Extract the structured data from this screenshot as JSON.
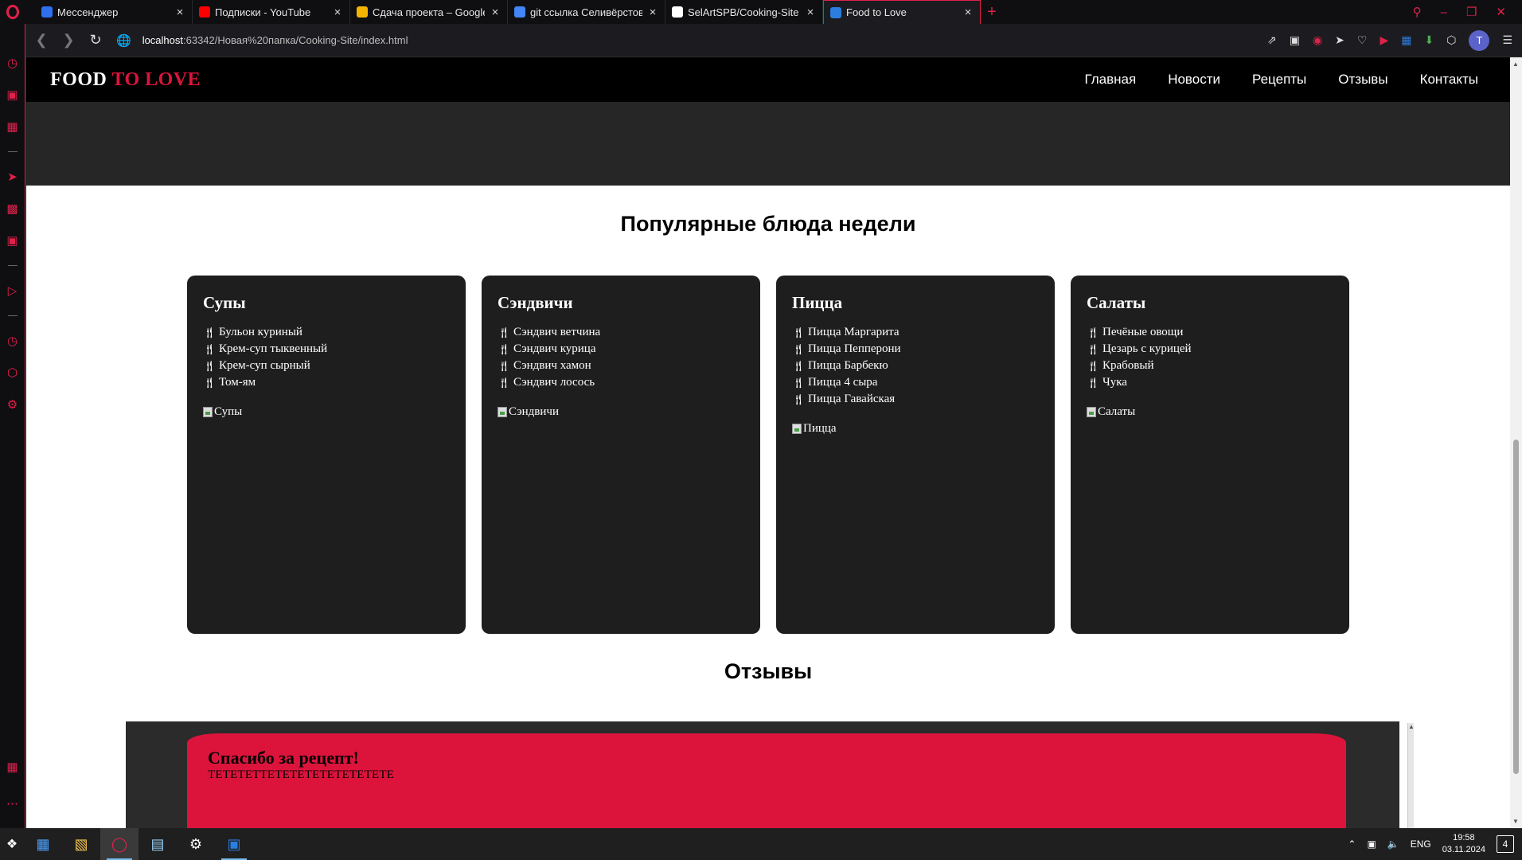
{
  "browser": {
    "tabs": [
      {
        "title": "Мессенджер",
        "favicon_color": "#2f6fed",
        "favicon": "icon-messenger"
      },
      {
        "title": "Подписки - YouTube",
        "favicon_color": "#ff0000",
        "favicon": "icon-youtube"
      },
      {
        "title": "Сдача проекта – Google Д",
        "favicon_color": "#f4b400",
        "favicon": "icon-google-drive"
      },
      {
        "title": "git ссылка Селивёрстов - (",
        "favicon_color": "#4285f4",
        "favicon": "icon-google-docs"
      },
      {
        "title": "SelArtSPB/Cooking-Site",
        "favicon_color": "#ffffff",
        "favicon": "icon-github"
      },
      {
        "title": "Food to Love",
        "favicon_color": "#2b7de0",
        "favicon": "icon-webstorm",
        "active": true
      }
    ],
    "url_host": "localhost",
    "url_path": ":63342/Новая%20папка/Cooking-Site/index.html",
    "profile_initial": "T"
  },
  "site": {
    "logo_main": "FOOD",
    "logo_accent": "TO LOVE",
    "nav": [
      "Главная",
      "Новости",
      "Рецепты",
      "Отзывы",
      "Контакты"
    ],
    "popular_title": "Популярные блюда недели",
    "cards": [
      {
        "title": "Супы",
        "items": [
          "Бульон куриный",
          "Крем-суп тыквенный",
          "Крем-суп сырный",
          "Том-ям"
        ],
        "img_alt": "Супы"
      },
      {
        "title": "Сэндвичи",
        "items": [
          "Сэндвич ветчина",
          "Сэндвич курица",
          "Сэндвич хамон",
          "Сэндвич лосось"
        ],
        "img_alt": "Сэндвичи"
      },
      {
        "title": "Пицца",
        "items": [
          "Пицца Маргарита",
          "Пицца Пепперони",
          "Пицца Барбекю",
          "Пицца 4 сыра",
          "Пицца Гавайская"
        ],
        "img_alt": "Пицца"
      },
      {
        "title": "Салаты",
        "items": [
          "Печёные овощи",
          "Цезарь с курицей",
          "Крабовый",
          "Чука"
        ],
        "img_alt": "Салаты"
      }
    ],
    "reviews_title": "Отзывы",
    "review": {
      "title": "Спасибо за рецепт!",
      "text": "ТЕТЕТЕТТЕТЕТЕТЕТЕТЕТЕТЕТЕ"
    }
  },
  "taskbar": {
    "lang": "ENG",
    "time": "19:58",
    "date": "03.11.2024",
    "notifications": "4"
  },
  "colors": {
    "accent": "#dc143c",
    "opera_red": "#e0204a"
  }
}
